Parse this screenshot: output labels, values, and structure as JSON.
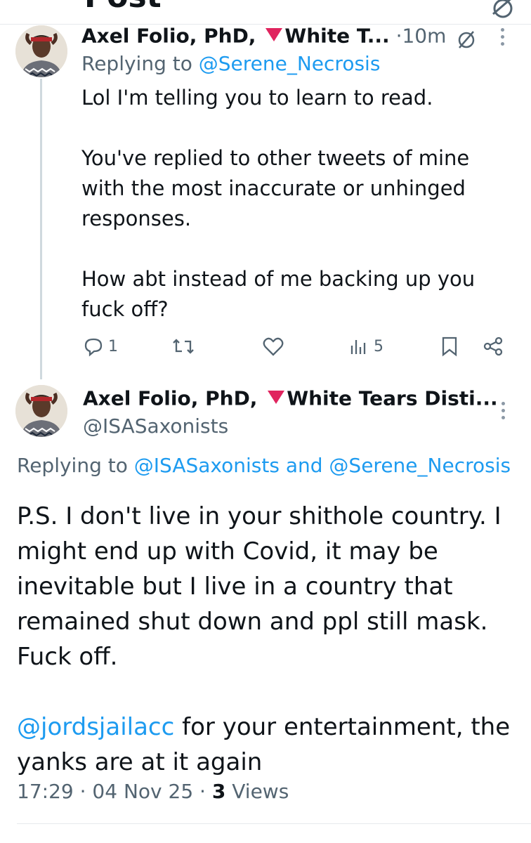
{
  "header": {
    "title": "Post"
  },
  "tweet1": {
    "name": "Axel Folio, PhD,",
    "name_suffix": "White T...",
    "separator": "·",
    "time": "10m",
    "replying_prefix": "Replying to",
    "replying_to": "@Serene_Necrosis",
    "paragraphs": [
      "Lol I'm telling you to learn to read.",
      "You've replied to other tweets of mine with the most inaccurate or unhinged responses.",
      "How abt instead of me backing up you fuck off?"
    ],
    "actions": {
      "reply_count": "1",
      "views_count": "5"
    }
  },
  "tweet2": {
    "name": "Axel Folio, PhD,",
    "name_suffix": "White Tears Disti...",
    "handle": "@ISASaxonists",
    "replying_prefix": "Replying to",
    "replying_to_1": "@ISASaxonists",
    "replying_and": "and",
    "replying_to_2": "@Serene_Necrosis",
    "paragraph1": "P.S. I don't live in your shithole country. I might end up with Covid, it may be inevitable but I live in a country that remained shut down and ppl still mask. Fuck off.",
    "mention": "@jordsjailacc",
    "paragraph2_rest": " for your entertainment, the yanks are at it again",
    "time": "17:29",
    "dot": "·",
    "date": "04 Nov 25",
    "views_count": "3",
    "views_label": "Views"
  },
  "colors": {
    "accent": "#1d9bf0",
    "secondary_text": "#536471",
    "flag_red": "#e0245e"
  }
}
